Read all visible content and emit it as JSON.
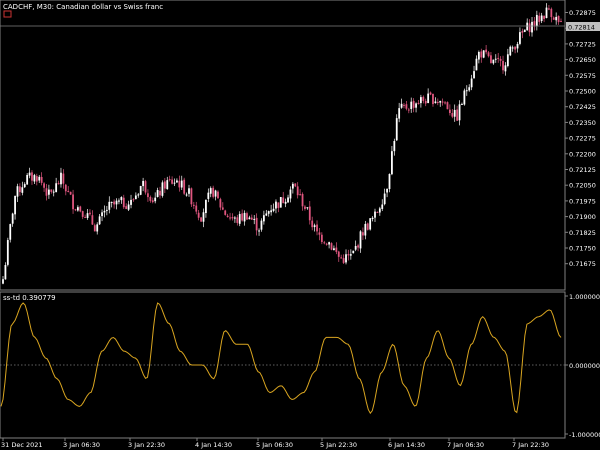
{
  "header": {
    "symbol_label": "CADCHF, M30:  Canadian dollar vs Swiss franc",
    "current_price_label": "0.72814"
  },
  "price_axis": {
    "ticks": [
      "0.72875",
      "0.72800",
      "0.72725",
      "0.72650",
      "0.72575",
      "0.72500",
      "0.72425",
      "0.72350",
      "0.72275",
      "0.72200",
      "0.72125",
      "0.72050",
      "0.71975",
      "0.71900",
      "0.71825",
      "0.71750",
      "0.71675"
    ]
  },
  "indicator": {
    "label": "ss-td 0.390779",
    "axis_ticks": [
      "1.000000",
      "0.000000",
      "-1.000000"
    ]
  },
  "time_axis": {
    "ticks": [
      "31 Dec 2021",
      "3 Jan 06:30",
      "3 Jan 22:30",
      "4 Jan 14:30",
      "5 Jan 06:30",
      "5 Jan 22:30",
      "6 Jan 14:30",
      "7 Jan 06:30",
      "7 Jan 22:30"
    ]
  },
  "colors": {
    "background": "#000000",
    "bull_candle": "#ffffff",
    "bear_candle": "#e0567f",
    "indicator_line": "#d9a520",
    "grid_line": "#808080",
    "current_price_badge": "#c0c0c0"
  },
  "chart_data": [
    {
      "type": "line",
      "title": "CADCHF, M30:  Canadian dollar vs Swiss franc",
      "xlabel": "",
      "ylabel": "",
      "x": [
        "31 Dec 2021",
        "3 Jan 06:30",
        "3 Jan 22:30",
        "4 Jan 14:30",
        "5 Jan 06:30",
        "5 Jan 22:30",
        "6 Jan 14:30",
        "7 Jan 06:30",
        "7 Jan 22:30"
      ],
      "ylim": [
        0.7164,
        0.7292
      ],
      "series": [
        {
          "values": [
            0.7168,
            0.7205,
            0.7213,
            0.7214,
            0.7205,
            0.7213,
            0.7202,
            0.7198,
            0.7191,
            0.72,
            0.7202,
            0.7202,
            0.7211,
            0.7203,
            0.7211,
            0.7212,
            0.7206,
            0.7196,
            0.7208,
            0.7198,
            0.7194,
            0.7197,
            0.7191,
            0.72,
            0.7203,
            0.721,
            0.72,
            0.7188,
            0.7185,
            0.7177,
            0.7178,
            0.719,
            0.7196,
            0.7209,
            0.7243,
            0.7246,
            0.7248,
            0.7249,
            0.7247,
            0.724,
            0.7255,
            0.727,
            0.7265,
            0.7264,
            0.7273,
            0.728,
            0.7284,
            0.7289,
            0.7281
          ]
        }
      ]
    },
    {
      "type": "line",
      "title": "ss-td 0.390779",
      "xlabel": "",
      "ylabel": "",
      "ylim": [
        -1.0,
        1.0
      ],
      "series": [
        {
          "values": [
            -0.6,
            0.6,
            0.9,
            0.4,
            0.1,
            -0.2,
            -0.5,
            -0.6,
            -0.4,
            0.2,
            0.4,
            0.2,
            0.1,
            -0.2,
            0.9,
            0.6,
            0.2,
            0.0,
            0.0,
            -0.2,
            0.5,
            0.3,
            0.3,
            -0.1,
            -0.4,
            -0.3,
            -0.5,
            -0.4,
            -0.1,
            0.4,
            0.4,
            0.3,
            -0.2,
            -0.7,
            -0.1,
            0.3,
            -0.3,
            -0.6,
            0.1,
            0.5,
            0.1,
            -0.3,
            0.3,
            0.7,
            0.4,
            0.2,
            -0.7,
            0.6,
            0.7,
            0.8,
            0.4
          ]
        }
      ]
    }
  ]
}
